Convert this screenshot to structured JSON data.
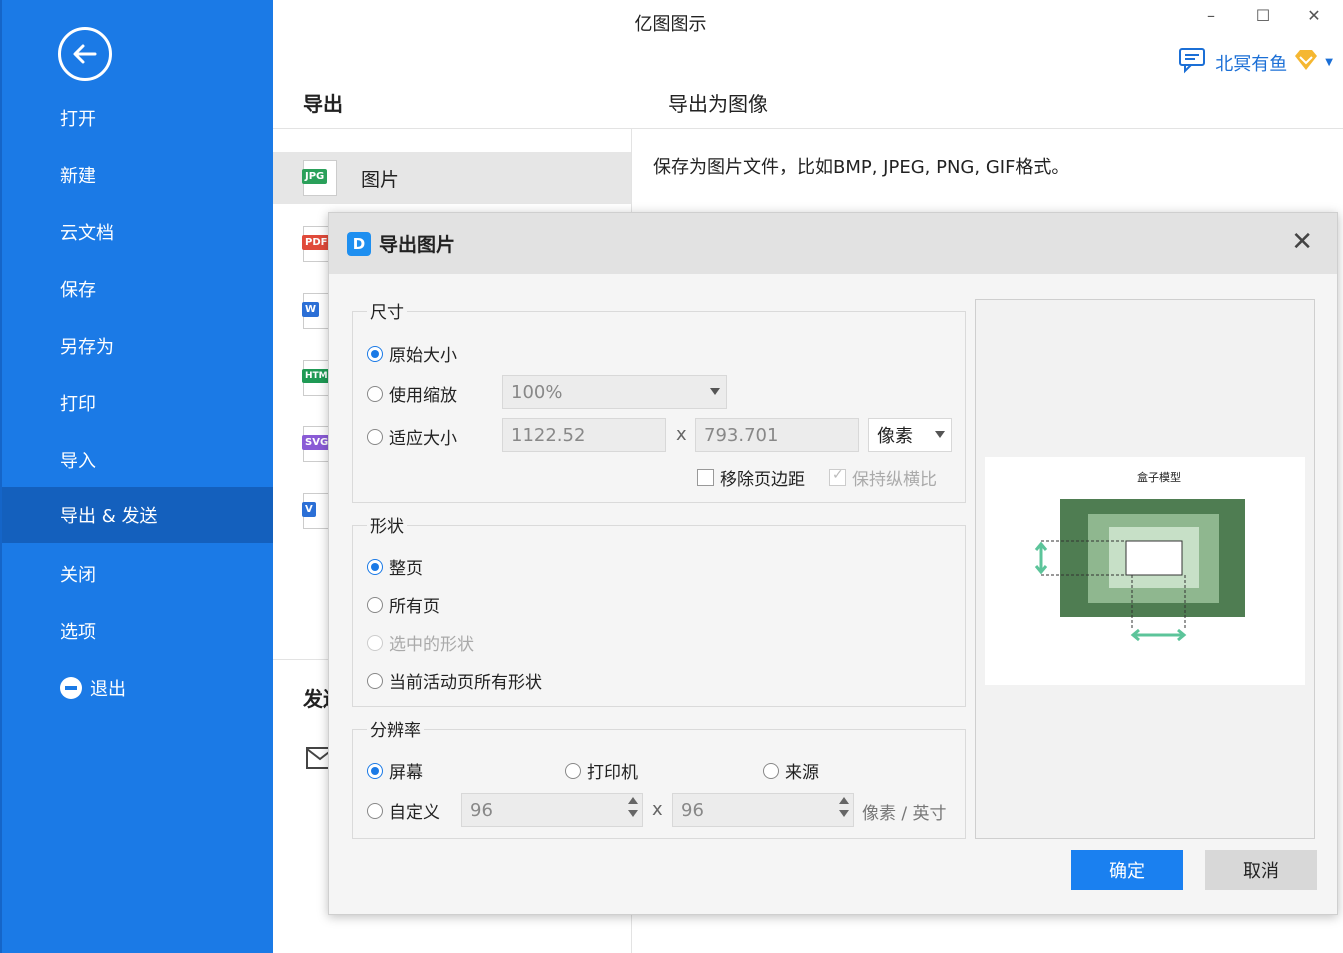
{
  "app": {
    "title": "亿图图示"
  },
  "window_controls": {
    "minimize": "–",
    "maximize": "☐",
    "close": "✕"
  },
  "user": {
    "name": "北冥有鱼",
    "chat_icon": "chat-icon",
    "vip_icon": "vip-diamond-icon"
  },
  "sidebar": {
    "back_icon": "back-arrow-icon",
    "items": [
      {
        "label": "打开"
      },
      {
        "label": "新建"
      },
      {
        "label": "云文档"
      },
      {
        "label": "保存"
      },
      {
        "label": "另存为"
      },
      {
        "label": "打印"
      },
      {
        "label": "导入"
      },
      {
        "label": "导出 & 发送",
        "active": true
      },
      {
        "label": "关闭"
      },
      {
        "label": "选项"
      },
      {
        "label": "退出"
      }
    ]
  },
  "export_panel": {
    "heading": "导出",
    "right_heading": "导出为图像",
    "description": "保存为图片文件，比如BMP, JPEG, PNG, GIF格式。",
    "formats": [
      {
        "badge": "JPG",
        "label": "图片",
        "color": "#2aa05a"
      },
      {
        "badge": "PDF",
        "label": "",
        "color": "#e04a3a"
      },
      {
        "badge": "W",
        "label": "",
        "color": "#2b6fd6"
      },
      {
        "badge": "HTML",
        "label": "",
        "color": "#1f9a55"
      },
      {
        "badge": "SVG",
        "label": "",
        "color": "#8a5bd6"
      },
      {
        "badge": "V",
        "label": "",
        "color": "#2b6fd6"
      }
    ],
    "send_heading": "发送"
  },
  "dialog": {
    "title": "导出图片",
    "logo": "D",
    "close": "✕",
    "size_group": {
      "title": "尺寸",
      "original": "原始大小",
      "zoom": "使用缩放",
      "zoom_value": "100%",
      "fit": "适应大小",
      "width": "1122.52",
      "x": "x",
      "height": "793.701",
      "unit": "像素",
      "remove_margin": "移除页边距",
      "keep_ratio": "保持纵横比"
    },
    "shape_group": {
      "title": "形状",
      "whole_page": "整页",
      "all_pages": "所有页",
      "selected": "选中的形状",
      "current_page_all": "当前活动页所有形状"
    },
    "resolution_group": {
      "title": "分辨率",
      "screen": "屏幕",
      "printer": "打印机",
      "source": "来源",
      "custom": "自定义",
      "dpi_x": "96",
      "x": "x",
      "dpi_y": "96",
      "unit": "像素 / 英寸"
    },
    "preview": {
      "title": "盒子模型"
    },
    "ok": "确定",
    "cancel": "取消"
  }
}
